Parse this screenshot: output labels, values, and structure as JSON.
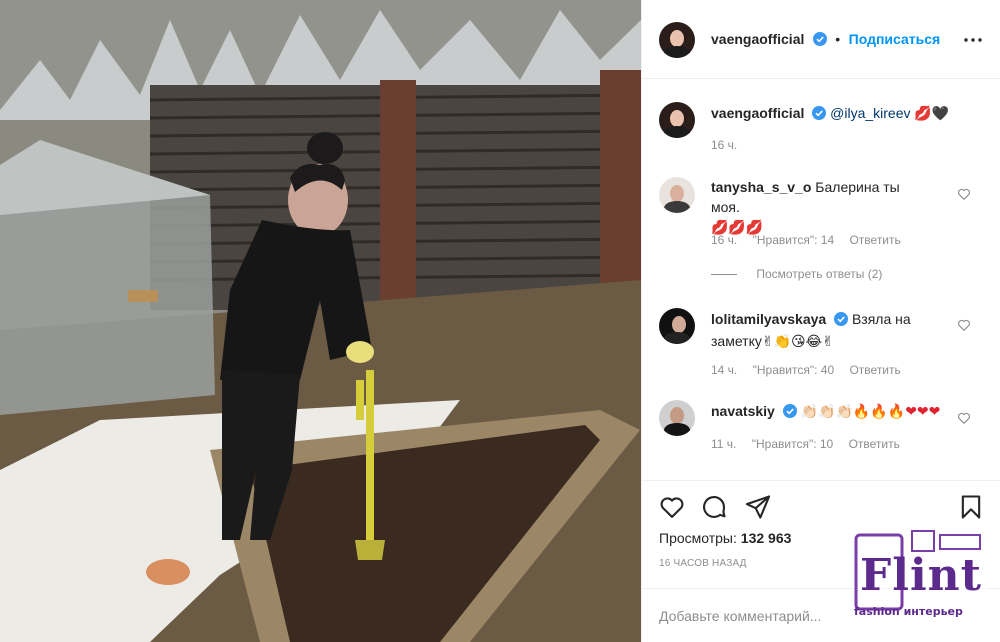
{
  "header": {
    "username": "vaengaofficial",
    "separator": "•",
    "follow_label": "Подписаться",
    "more_icon": "more-horizontal-icon"
  },
  "caption": {
    "username": "vaengaofficial",
    "text": "@ilya_kireev 💋🖤",
    "time": "16 ч."
  },
  "comments": [
    {
      "username": "tanysha_s_v_o",
      "text": "Балерина ты моя.",
      "text2": "💋💋💋",
      "time": "16 ч.",
      "likes": "\"Нравится\": 14",
      "reply": "Ответить",
      "view_replies": "Посмотреть ответы (2)"
    },
    {
      "username": "lolitamilyavskaya",
      "text": "Взяла на",
      "text2": "заметку✌👏😘😂✌",
      "time": "14 ч.",
      "likes": "\"Нравится\": 40",
      "reply": "Ответить"
    },
    {
      "username": "navatskiy",
      "text": "👏🏻👏🏻👏🏻🔥🔥🔥❤❤❤",
      "time": "11 ч.",
      "likes": "\"Нравится\": 10",
      "reply": "Ответить"
    }
  ],
  "actions": {
    "views_label": "Просмотры:",
    "views_count": "132 963",
    "posted": "16 часов назад",
    "comment_placeholder": "Добавьте комментарий..."
  },
  "watermark": {
    "logo_text": "Flint",
    "subtitle": "fashion интерьер"
  },
  "colors": {
    "accent": "#0095f6",
    "muted": "#8e8e8e",
    "verified": "#3897f0",
    "border": "#efefef",
    "watermark": "#5b2a8c"
  }
}
